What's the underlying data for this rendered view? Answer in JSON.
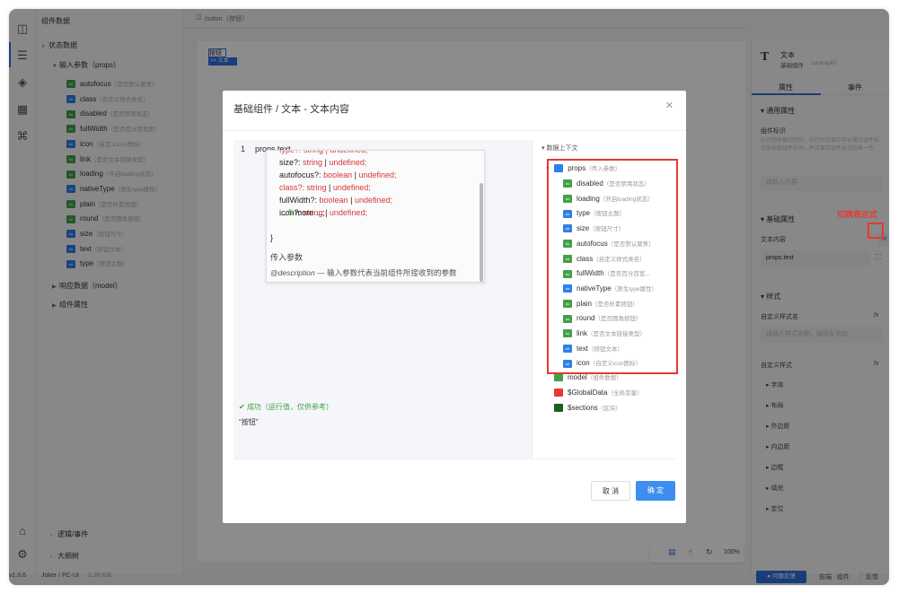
{
  "left_panel": {
    "title": "组件数据",
    "state_section": "状态数据",
    "props_group": "输入参数（props）",
    "props": [
      {
        "name": "autofocus",
        "desc": "（是否默认聚焦）",
        "tag": "bo",
        "color": "green"
      },
      {
        "name": "class",
        "desc": "（自定义样式类名）",
        "tag": "str",
        "color": "blue"
      },
      {
        "name": "disabled",
        "desc": "（是否禁用状态）",
        "tag": "bo",
        "color": "green"
      },
      {
        "name": "fullWidth",
        "desc": "（是否百分百宽度）",
        "tag": "bo",
        "color": "green"
      },
      {
        "name": "icon",
        "desc": "（自定义icon图标）",
        "tag": "str",
        "color": "blue"
      },
      {
        "name": "link",
        "desc": "（是否文本链接类型）",
        "tag": "bo",
        "color": "green"
      },
      {
        "name": "loading",
        "desc": "（开启loading状态）",
        "tag": "bo",
        "color": "green"
      },
      {
        "name": "nativeType",
        "desc": "（原生type属性）",
        "tag": "str",
        "color": "blue"
      },
      {
        "name": "plain",
        "desc": "（是否朴素按钮）",
        "tag": "bo",
        "color": "green"
      },
      {
        "name": "round",
        "desc": "（是否圆角按钮）",
        "tag": "bo",
        "color": "green"
      },
      {
        "name": "size",
        "desc": "（按钮尺寸）",
        "tag": "str",
        "color": "blue"
      },
      {
        "name": "text",
        "desc": "（按钮文本）",
        "tag": "str",
        "color": "blue"
      },
      {
        "name": "type",
        "desc": "（按钮主题）",
        "tag": "str",
        "color": "blue"
      }
    ],
    "model_group": "响应数据（model）",
    "component_attrs": "组件属性",
    "logic_events": "逻辑/事件",
    "outline": "大纲树"
  },
  "canvas": {
    "tab_title": "button（按钮）",
    "selected_text": "按钮",
    "selected_label": ">> 文本",
    "zoom": "100%"
  },
  "right_panel": {
    "comp_title": "文本",
    "comp_sub": "基础组件",
    "comp_id": "1anhagk0",
    "tab_attrs": "属性",
    "tab_events": "事件",
    "general_section": "通用属性",
    "comp_id_label": "组件标识",
    "comp_id_hint": "标识用来被识别的，在代码页面中可以通过组件标识来获取组件实例，并且保持组件标识的唯一性",
    "comp_id_placeholder": "请输入内容",
    "basic_section": "基础属性",
    "text_content_label": "文本内容",
    "text_content_value": "props.text",
    "style_section": "样式",
    "class_label": "自定义样式名",
    "class_placeholder": "请输入样式名称，按回车添加",
    "custom_style_label": "自定义样式",
    "style_items": [
      "字体",
      "布局",
      "外边距",
      "内边距",
      "边框",
      "填充",
      "定位"
    ],
    "fx": "fx"
  },
  "status_bar": {
    "version": "v1.0.6",
    "project": "Joker / PC-UI",
    "size": "3.38 KiB",
    "feedback": "问题反馈",
    "links": [
      "前端",
      "组件",
      "反馈"
    ]
  },
  "modal": {
    "title": "基础组件 / 文本 - 文本内容",
    "line_no": "1",
    "code": "props.text",
    "popup": {
      "line_type": "type?: string | undefined;",
      "lines": [
        {
          "key": "size?:",
          "type": "string",
          "sep": " | ",
          "undef": "undefined;"
        },
        {
          "key": "autofocus?:",
          "type": "boolean",
          "sep": " | ",
          "undef": "undefined;"
        },
        {
          "key": "class?:",
          "type": "string",
          "sep": " | ",
          "undef": "undefined;"
        },
        {
          "key": "fullWidth?:",
          "type": "boolean",
          "sep": " | ",
          "undef": "undefined;"
        },
        {
          "key": "icon?:",
          "type": "string",
          "sep": " | ",
          "undef": "undefined;"
        }
      ],
      "more_prefix": "...",
      "more_count": "5",
      "more_suffix": "more ...;",
      "close_brace": "}",
      "label": "传入参数",
      "description_tag": "@description",
      "description": "— 输入参数代表当前组件所接收到的参数"
    },
    "result_status": "成功（运行值，仅供参考）",
    "result_value": "\"按钮\"",
    "ctx_title": "数据上下文",
    "ctx_props": "props",
    "ctx_props_desc": "（传入参数）",
    "ctx_items": [
      {
        "name": "disabled",
        "desc": "（是否禁用状态）",
        "tag": "bo",
        "color": "green"
      },
      {
        "name": "loading",
        "desc": "（开启loading状态）",
        "tag": "bo",
        "color": "green"
      },
      {
        "name": "type",
        "desc": "（按钮主题）",
        "tag": "str",
        "color": "blue"
      },
      {
        "name": "size",
        "desc": "（按钮尺寸）",
        "tag": "str",
        "color": "blue"
      },
      {
        "name": "autofocus",
        "desc": "（是否默认聚焦）",
        "tag": "bo",
        "color": "green"
      },
      {
        "name": "class",
        "desc": "（自定义样式类名）",
        "tag": "str",
        "color": "green"
      },
      {
        "name": "fullWidth",
        "desc": "（是否百分百宽...",
        "tag": "bo",
        "color": "green"
      },
      {
        "name": "nativeType",
        "desc": "（原生type属性）",
        "tag": "str",
        "color": "blue"
      },
      {
        "name": "plain",
        "desc": "（是否朴素按钮）",
        "tag": "bo",
        "color": "green"
      },
      {
        "name": "round",
        "desc": "（是否圆角按钮）",
        "tag": "bo",
        "color": "green"
      },
      {
        "name": "link",
        "desc": "（是否文本链接类型）",
        "tag": "bo",
        "color": "green"
      },
      {
        "name": "text",
        "desc": "（按钮文本）",
        "tag": "str",
        "color": "blue"
      },
      {
        "name": "icon",
        "desc": "（自定义icon图标）",
        "tag": "str",
        "color": "blue"
      }
    ],
    "ctx_model": "model",
    "ctx_model_desc": "（组件数据）",
    "ctx_global": "$GlobalData",
    "ctx_global_desc": "（全局变量）",
    "ctx_sections": "$sections",
    "ctx_sections_desc": "（区块）",
    "cancel": "取 消",
    "confirm": "确 定"
  },
  "annotation": "切换表达式",
  "colors": {
    "accent": "#2f6fde",
    "primary_button": "#3d8ef0",
    "red": "#e53935",
    "green_tag": "#43a047",
    "blue_tag": "#2f7fe8"
  }
}
